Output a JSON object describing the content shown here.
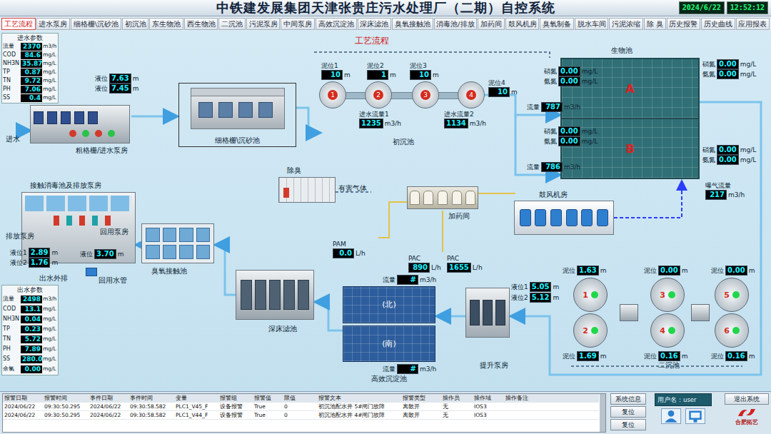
{
  "header": {
    "title": "中铁建发展集团天津张贵庄污水处理厂（二期）自控系统",
    "date": "2024/6/22",
    "time": "12:52:12"
  },
  "tabs": [
    {
      "label": "工艺流程",
      "selected": true
    },
    {
      "label": "进水泵房",
      "selected": false
    },
    {
      "label": "细格栅\\沉砂池",
      "selected": false
    },
    {
      "label": "初沉池",
      "selected": false
    },
    {
      "label": "东生物池",
      "selected": false
    },
    {
      "label": "西生物池",
      "selected": false
    },
    {
      "label": "二沉池",
      "selected": false
    },
    {
      "label": "污泥泵房",
      "selected": false
    },
    {
      "label": "中间泵房",
      "selected": false
    },
    {
      "label": "高效沉淀池",
      "selected": false
    },
    {
      "label": "深床滤池",
      "selected": false
    },
    {
      "label": "臭氧接触池",
      "selected": false
    },
    {
      "label": "消毒池/排放",
      "selected": false
    },
    {
      "label": "加药间",
      "selected": false
    },
    {
      "label": "鼓风机房",
      "selected": false
    },
    {
      "label": "臭氧制备",
      "selected": false
    },
    {
      "label": "脱水车间",
      "selected": false
    },
    {
      "label": "污泥浓缩",
      "selected": false
    },
    {
      "label": "除 臭",
      "selected": false
    },
    {
      "label": "历史报警",
      "selected": false
    },
    {
      "label": "历史曲线",
      "selected": false
    },
    {
      "label": "应用报表",
      "selected": false
    }
  ],
  "canvas_title": "工艺流程",
  "inlet_params": {
    "title": "进水参数",
    "rows": [
      {
        "name": "流量",
        "value": "2370",
        "unit": "m3/h"
      },
      {
        "name": "COD",
        "value": "84.6",
        "unit": "mg/L"
      },
      {
        "name": "NH3N",
        "value": "35.87",
        "unit": "mg/L"
      },
      {
        "name": "TP",
        "value": "0.87",
        "unit": "mg/L"
      },
      {
        "name": "TN",
        "value": "9.72",
        "unit": "mg/L"
      },
      {
        "name": "PH",
        "value": "7.06",
        "unit": "mg/L"
      },
      {
        "name": "SS",
        "value": "0.4",
        "unit": "mg/L"
      }
    ]
  },
  "intake": {
    "label": "进水"
  },
  "coarse_screen": {
    "label": "粗格栅/进水泵房",
    "readings": [
      {
        "name": "液位",
        "value": "7.63",
        "unit": "m"
      },
      {
        "name": "液位",
        "value": "7.45",
        "unit": "m"
      }
    ]
  },
  "fine_screen": {
    "label": "细格栅\\沉砂池"
  },
  "primary": {
    "label": "初沉池",
    "tanks": [
      {
        "number": "1",
        "name": "泥位1",
        "value": "10",
        "unit": "m"
      },
      {
        "number": "2",
        "name": "泥位2",
        "value": "1",
        "unit": "m"
      },
      {
        "number": "3",
        "name": "泥位3",
        "value": "10",
        "unit": "m"
      },
      {
        "number": "4",
        "name": "泥位4",
        "value": "10",
        "unit": "m"
      }
    ],
    "flows": [
      {
        "name": "进水流量1",
        "value": "1235",
        "unit": "m3/h"
      },
      {
        "name": "进水流量2",
        "value": "1134",
        "unit": "m3/h"
      }
    ]
  },
  "bio": {
    "label": "生物池",
    "zones": [
      "A",
      "B"
    ],
    "flows": [
      {
        "name": "流量",
        "value": "787",
        "unit": "m3/h"
      },
      {
        "name": "流量",
        "value": "786",
        "unit": "m3/h"
      }
    ],
    "sensors": [
      [
        {
          "name": "硝氮",
          "value": "0.00",
          "unit": "mg/L"
        },
        {
          "name": "氨氮",
          "value": "0.00",
          "unit": "mg/L"
        }
      ],
      [
        {
          "name": "硝氮",
          "value": "0.00",
          "unit": "mg/L"
        },
        {
          "name": "氨氮",
          "value": "0.00",
          "unit": "mg/L"
        }
      ],
      [
        {
          "name": "硝氮",
          "value": "0.00",
          "unit": "mg/L"
        },
        {
          "name": "氨氮",
          "value": "0.00",
          "unit": "mg/L"
        }
      ],
      [
        {
          "name": "硝氮",
          "value": "0.00",
          "unit": "mg/L"
        },
        {
          "name": "氨氮",
          "value": "0.00",
          "unit": "mg/L"
        }
      ]
    ],
    "aeration": {
      "name": "曝气流量",
      "value": "217",
      "unit": "m3/h"
    }
  },
  "blower": {
    "label": "鼓风机房"
  },
  "deodor": {
    "label": "除臭",
    "gas": "有害气体"
  },
  "dosing": {
    "label": "加药间",
    "chemicals": [
      {
        "name": "PAM",
        "value": "0.0",
        "unit": "L/h"
      },
      {
        "name": "PAC",
        "value": "890",
        "unit": "L/h"
      },
      {
        "name": "PAC",
        "value": "1655",
        "unit": "L/h"
      }
    ]
  },
  "secondary": {
    "label": "二沉池",
    "tanks": [
      {
        "number": "1",
        "name": "泥位",
        "value": "1.63",
        "unit": "m",
        "running": true
      },
      {
        "number": "2",
        "name": "泥位",
        "value": "1.69",
        "unit": "m",
        "running": true
      },
      {
        "number": "3",
        "name": "泥位",
        "value": "0.00",
        "unit": "m",
        "running": true
      },
      {
        "number": "4",
        "name": "泥位",
        "value": "0.16",
        "unit": "m",
        "running": true
      },
      {
        "number": "5",
        "name": "泥位",
        "value": "0.00",
        "unit": "m",
        "running": true
      },
      {
        "number": "6",
        "name": "泥位",
        "value": "0.16",
        "unit": "m",
        "running": true
      }
    ]
  },
  "lift": {
    "label": "提升泵房",
    "readings": [
      {
        "name": "液位1",
        "value": "5.05",
        "unit": "m"
      },
      {
        "name": "液位2",
        "value": "5.12",
        "unit": "m"
      }
    ]
  },
  "hds": {
    "label": "高效沉淀池",
    "basins": [
      "(北)",
      "(南)"
    ],
    "flows": [
      {
        "name": "流量",
        "value": "#",
        "unit": "m3/h"
      },
      {
        "name": "流量",
        "value": "#",
        "unit": "m3/h"
      }
    ]
  },
  "filter": {
    "label": "深床滤池"
  },
  "ozone": {
    "label": "臭氧接触池"
  },
  "disinfection": {
    "label": "接触消毒池及排放泵房",
    "discharge_pump": "排放泵房",
    "reuse_pump": "回用泵房",
    "readings": [
      {
        "name": "液位1",
        "value": "2.89",
        "unit": "m"
      },
      {
        "name": "液位2",
        "value": "1.76",
        "unit": "m"
      }
    ],
    "reuse_reading": {
      "name": "液位",
      "value": "3.70",
      "unit": "m"
    },
    "outfall": "出水外排",
    "reuse_pipe": "回用水管"
  },
  "outlet_params": {
    "title": "出水参数",
    "rows": [
      {
        "name": "流量",
        "value": "2498",
        "unit": "m3/h"
      },
      {
        "name": "COD",
        "value": "13.1",
        "unit": "mg/L"
      },
      {
        "name": "NH3N",
        "value": "0.04",
        "unit": "mg/L"
      },
      {
        "name": "TP",
        "value": "0.23",
        "unit": "mg/L"
      },
      {
        "name": "TN",
        "value": "5.72",
        "unit": "mg/L"
      },
      {
        "name": "PH",
        "value": "7.89",
        "unit": "mg/L"
      },
      {
        "name": "SS",
        "value": "280.0",
        "unit": "mg/L"
      },
      {
        "name": "余氯",
        "value": "0.00",
        "unit": "mg/L"
      }
    ]
  },
  "alarms": {
    "columns": [
      "报警日期",
      "报警时间",
      "事件日期",
      "事件时间",
      "变量",
      "报警组",
      "报警值",
      "限值",
      "报警文本",
      "报警类型",
      "操作员",
      "操作域",
      "操作备注"
    ],
    "rows": [
      [
        "2024/06/22",
        "09:30:50.295",
        "2024/06/22",
        "09:30:58.582",
        "PLC1_V45_F",
        "设备报警",
        "True",
        "0",
        "初沉池配水井 5#闸门故障",
        "离散开",
        "无",
        "IOS3",
        ""
      ],
      [
        "2024/06/22",
        "09:30:50.295",
        "2024/06/22",
        "09:30:58.582",
        "PLC1_V44_F",
        "设备报警",
        "True",
        "0",
        "初沉池配水井 4#闸门故障",
        "离散开",
        "无",
        "IOS3",
        ""
      ]
    ]
  },
  "controls": {
    "system_info": "系统信息",
    "reset_buttons": [
      "复位",
      "复位"
    ],
    "user": "用户名：user",
    "exit": "退出系统",
    "logo": "合肥拓艺"
  }
}
